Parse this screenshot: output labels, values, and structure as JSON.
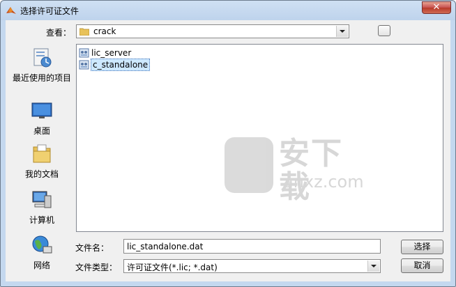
{
  "window": {
    "title": "选择许可证文件",
    "close_glyph": "✕"
  },
  "lookin": {
    "label": "查看：",
    "value": "crack"
  },
  "places": [
    {
      "label": "最近使用的项目",
      "icon": "recent-items-icon"
    },
    {
      "label": "桌面",
      "icon": "desktop-icon"
    },
    {
      "label": "我的文档",
      "icon": "documents-icon"
    },
    {
      "label": "计算机",
      "icon": "computer-icon"
    },
    {
      "label": "网络",
      "icon": "network-icon"
    }
  ],
  "files": [
    {
      "name": "lic_server",
      "icon": "license-file-icon"
    },
    {
      "name": "c_standalone",
      "icon": "license-file-icon"
    }
  ],
  "watermark": {
    "text": "安下载",
    "sub": "anxz.com"
  },
  "filename": {
    "label": "文件名：",
    "value": "lic_standalone.dat"
  },
  "filetype": {
    "label": "文件类型：",
    "value": "许可证文件(*.lic; *.dat)"
  },
  "buttons": {
    "ok": "选择",
    "cancel": "取消"
  }
}
